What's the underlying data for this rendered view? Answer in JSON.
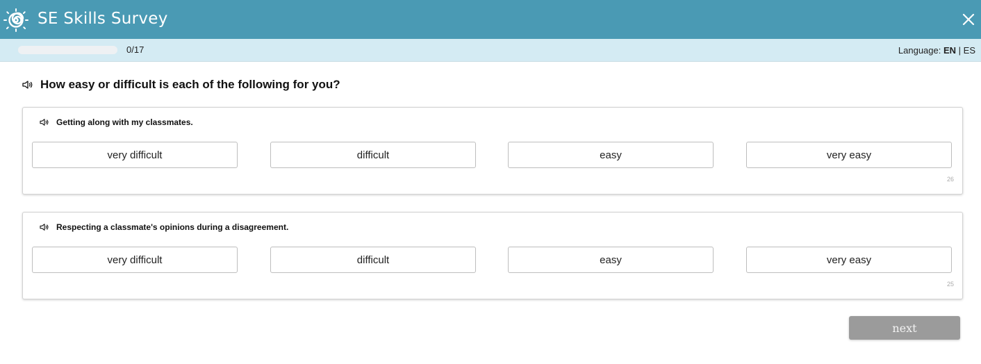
{
  "app": {
    "title": "SE Skills Survey",
    "logo_icon": "sun-spiral-icon",
    "close_icon": "close-icon",
    "brand_color": "#4a9ab4"
  },
  "progress": {
    "label": "0/17",
    "fraction": 0
  },
  "language": {
    "prefix": "Language: ",
    "options": [
      "EN",
      "ES"
    ],
    "separator": " | ",
    "selected": "EN"
  },
  "question": {
    "text": "How easy or difficult is each of the following for you?",
    "audio_icon": "speaker-icon"
  },
  "items": [
    {
      "text": "Getting along with my classmates.",
      "id": "26",
      "options": [
        "very difficult",
        "difficult",
        "easy",
        "very easy"
      ]
    },
    {
      "text": "Respecting a classmate's opinions during a disagreement.",
      "id": "25",
      "options": [
        "very difficult",
        "difficult",
        "easy",
        "very easy"
      ]
    }
  ],
  "footer": {
    "next_label": "next"
  }
}
